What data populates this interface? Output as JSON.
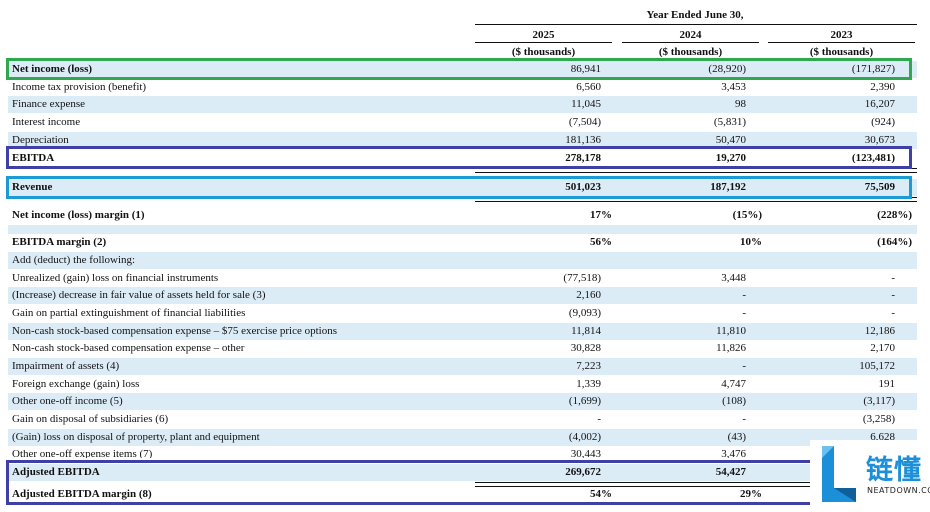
{
  "header": {
    "period": "Year Ended June 30,",
    "years": [
      "2025",
      "2024",
      "2023"
    ],
    "unit": "($ thousands)"
  },
  "rows": [
    {
      "label": "Net income (loss)",
      "v2025": "86,941",
      "v2024": "(28,920)",
      "v2023": "(171,827)"
    },
    {
      "label": "Income tax provision (benefit)",
      "v2025": "6,560",
      "v2024": "3,453",
      "v2023": "2,390"
    },
    {
      "label": "Finance expense",
      "v2025": "11,045",
      "v2024": "98",
      "v2023": "16,207"
    },
    {
      "label": "Interest income",
      "v2025": "(7,504)",
      "v2024": "(5,831)",
      "v2023": "(924)"
    },
    {
      "label": "Depreciation",
      "v2025": "181,136",
      "v2024": "50,470",
      "v2023": "30,673"
    },
    {
      "label": "EBITDA",
      "v2025": "278,178",
      "v2024": "19,270",
      "v2023": "(123,481)"
    },
    {
      "label": "Revenue",
      "v2025": "501,023",
      "v2024": "187,192",
      "v2023": "75,509"
    },
    {
      "label": "Net income (loss) margin (1)",
      "v2025": "17%",
      "v2024": "(15%)",
      "v2023": "(228%)"
    },
    {
      "label": "EBITDA margin (2)",
      "v2025": "56%",
      "v2024": "10%",
      "v2023": "(164%)"
    },
    {
      "label": "Add (deduct) the following:",
      "v2025": "",
      "v2024": "",
      "v2023": ""
    },
    {
      "label": "Unrealized (gain) loss on financial instruments",
      "v2025": "(77,518)",
      "v2024": "3,448",
      "v2023": "-"
    },
    {
      "label": "(Increase) decrease in fair value of assets held for sale (3)",
      "v2025": "2,160",
      "v2024": "-",
      "v2023": "-"
    },
    {
      "label": "Gain on partial extinguishment of financial liabilities",
      "v2025": "(9,093)",
      "v2024": "-",
      "v2023": "-"
    },
    {
      "label": "Non-cash stock-based compensation expense – $75 exercise price options",
      "v2025": "11,814",
      "v2024": "11,810",
      "v2023": "12,186"
    },
    {
      "label": "Non-cash stock-based compensation expense – other",
      "v2025": "30,828",
      "v2024": "11,826",
      "v2023": "2,170"
    },
    {
      "label": "Impairment of assets (4)",
      "v2025": "7,223",
      "v2024": "-",
      "v2023": "105,172"
    },
    {
      "label": "Foreign exchange (gain) loss",
      "v2025": "1,339",
      "v2024": "4,747",
      "v2023": "191"
    },
    {
      "label": "Other one-off income (5)",
      "v2025": "(1,699)",
      "v2024": "(108)",
      "v2023": "(3,117)"
    },
    {
      "label": "Gain on disposal of subsidiaries (6)",
      "v2025": "-",
      "v2024": "-",
      "v2023": "(3,258)"
    },
    {
      "label": "(Gain) loss on disposal of property, plant and equipment",
      "v2025": "(4,002)",
      "v2024": "(43)",
      "v2023": "6,628"
    },
    {
      "label": "Other one-off expense items (7)",
      "v2025": "30,443",
      "v2024": "3,476",
      "v2023": ""
    },
    {
      "label": "Adjusted EBITDA",
      "v2025": "269,672",
      "v2024": "54,427",
      "v2023": ""
    },
    {
      "label": "Adjusted EBITDA margin (8)",
      "v2025": "54%",
      "v2024": "29%",
      "v2023": ""
    }
  ],
  "watermark": {
    "text": "链懂",
    "sub": "NEATDOWN.COM"
  },
  "colors": {
    "row_tint": "#dcecf7",
    "green_box": "#2fa84f",
    "navy_box": "#3f3fa8",
    "cyan_box": "#1b9ad6",
    "watermark": "#1b8fd8"
  }
}
